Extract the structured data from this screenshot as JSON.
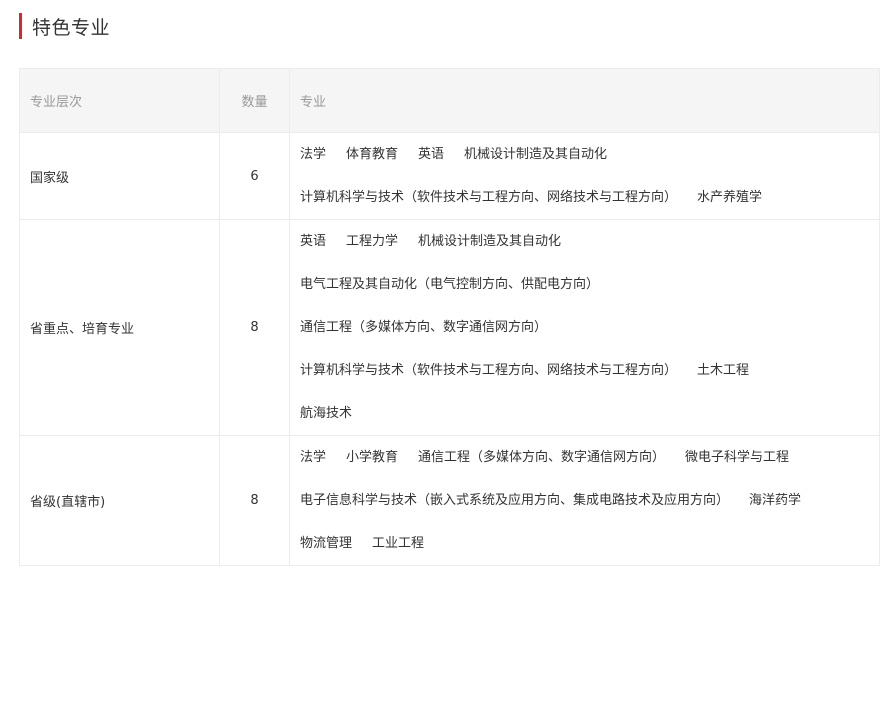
{
  "section": {
    "title": "特色专业",
    "accent_color": "#d9252b"
  },
  "table": {
    "headers": {
      "level": "专业层次",
      "count": "数量",
      "majors": "专业"
    },
    "rows": [
      {
        "level": "国家级",
        "count": "6",
        "lines": [
          [
            "法学",
            "体育教育",
            "英语",
            "机械设计制造及其自动化"
          ],
          [
            "计算机科学与技术（软件技术与工程方向、网络技术与工程方向）",
            "水产养殖学"
          ]
        ]
      },
      {
        "level": "省重点、培育专业",
        "count": "8",
        "lines": [
          [
            "英语",
            "工程力学",
            "机械设计制造及其自动化"
          ],
          [
            "电气工程及其自动化（电气控制方向、供配电方向）"
          ],
          [
            "通信工程（多媒体方向、数字通信网方向）"
          ],
          [
            "计算机科学与技术（软件技术与工程方向、网络技术与工程方向）",
            "土木工程"
          ],
          [
            "航海技术"
          ]
        ]
      },
      {
        "level": "省级(直辖市)",
        "count": "8",
        "lines": [
          [
            "法学",
            "小学教育",
            "通信工程（多媒体方向、数字通信网方向）",
            "微电子科学与工程"
          ],
          [
            "电子信息科学与技术（嵌入式系统及应用方向、集成电路技术及应用方向）",
            "海洋药学"
          ],
          [
            "物流管理",
            "工业工程"
          ]
        ]
      }
    ]
  }
}
